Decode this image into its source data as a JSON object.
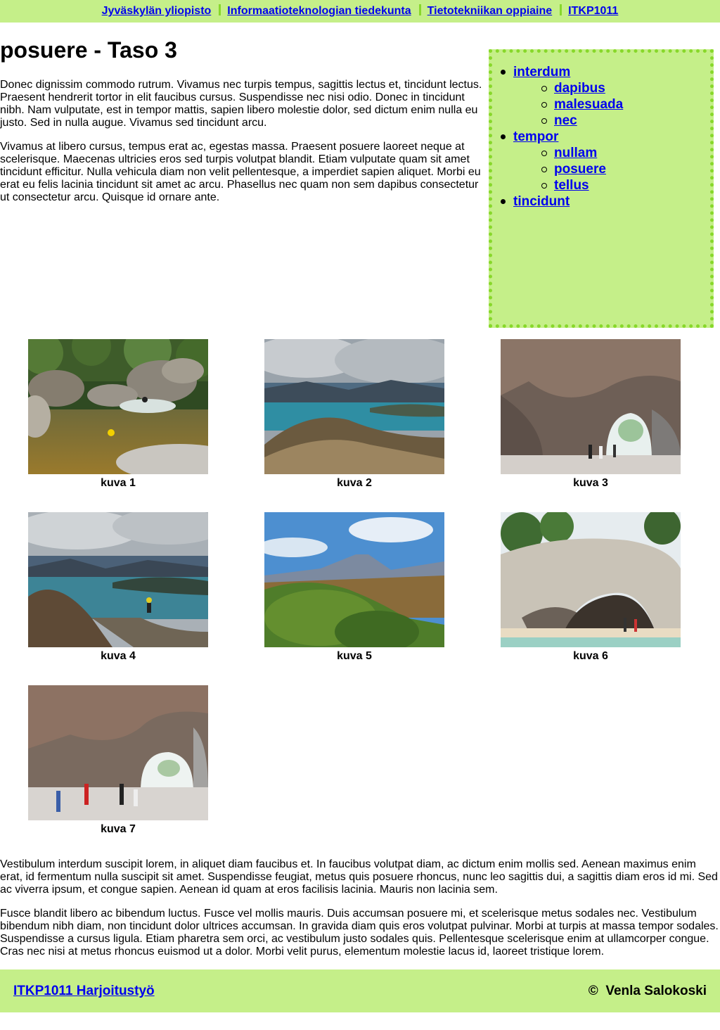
{
  "breadcrumbs": [
    {
      "label": "Jyväskylän yliopisto"
    },
    {
      "label": "Informaatioteknologian tiedekunta"
    },
    {
      "label": "Tietotekniikan oppiaine"
    },
    {
      "label": "ITKP1011"
    }
  ],
  "page": {
    "title": "posuere - Taso 3",
    "intro": [
      "Donec dignissim commodo rutrum. Vivamus nec turpis tempus, sagittis lectus et, tincidunt lectus. Praesent hendrerit tortor in elit faucibus cursus. Suspendisse nec nisi odio. Donec in tincidunt nibh. Nam vulputate, est in tempor mattis, sapien libero molestie dolor, sed dictum enim nulla eu justo. Sed in nulla augue. Vivamus sed tincidunt arcu.",
      "Vivamus at libero cursus, tempus erat ac, egestas massa. Praesent posuere laoreet neque at scelerisque. Maecenas ultricies eros sed turpis volutpat blandit. Etiam vulputate quam sit amet tincidunt efficitur. Nulla vehicula diam non velit pellentesque, a imperdiet sapien aliquet. Morbi eu erat eu felis lacinia tincidunt sit amet ac arcu. Phasellus nec quam non sem dapibus consectetur ut consectetur arcu. Quisque id ornare ante."
    ],
    "outro": [
      "Vestibulum interdum suscipit lorem, in aliquet diam faucibus et. In faucibus volutpat diam, ac dictum enim mollis sed. Aenean maximus enim erat, id fermentum nulla suscipit sit amet. Suspendisse feugiat, metus quis posuere rhoncus, nunc leo sagittis dui, a sagittis diam eros id mi. Sed ac viverra ipsum, et congue sapien. Aenean id quam at eros facilisis lacinia. Mauris non lacinia sem.",
      "Fusce blandit libero ac bibendum luctus. Fusce vel mollis mauris. Duis accumsan posuere mi, et scelerisque metus sodales nec. Vestibulum bibendum nibh diam, non tincidunt dolor ultrices accumsan. In gravida diam quis eros volutpat pulvinar. Morbi at turpis at massa tempor sodales. Suspendisse a cursus ligula. Etiam pharetra sem orci, ac vestibulum justo sodales quis. Pellentesque scelerisque enim at ullamcorper congue. Cras nec nisi at metus rhoncus euismod ut a dolor. Morbi velit purus, elementum molestie lacus id, laoreet tristique lorem."
    ]
  },
  "nav": [
    {
      "label": "interdum",
      "children": [
        {
          "label": "dapibus"
        },
        {
          "label": "malesuada"
        },
        {
          "label": "nec"
        }
      ]
    },
    {
      "label": "tempor",
      "children": [
        {
          "label": "nullam"
        },
        {
          "label": "posuere"
        },
        {
          "label": "tellus"
        }
      ]
    },
    {
      "label": "tincidunt",
      "children": []
    }
  ],
  "gallery": [
    {
      "caption": "kuva 1"
    },
    {
      "caption": "kuva 2"
    },
    {
      "caption": "kuva 3"
    },
    {
      "caption": "kuva 4"
    },
    {
      "caption": "kuva 5"
    },
    {
      "caption": "kuva 6"
    },
    {
      "caption": "kuva 7"
    }
  ],
  "footer": {
    "link_label": "ITKP1011 Harjoitustyö",
    "copyright_symbol": "©",
    "author": "Venla Salokoski"
  },
  "colors": {
    "accent_light": "#c5ef89",
    "accent_dark": "#88d82b",
    "link": "#0000ee"
  }
}
